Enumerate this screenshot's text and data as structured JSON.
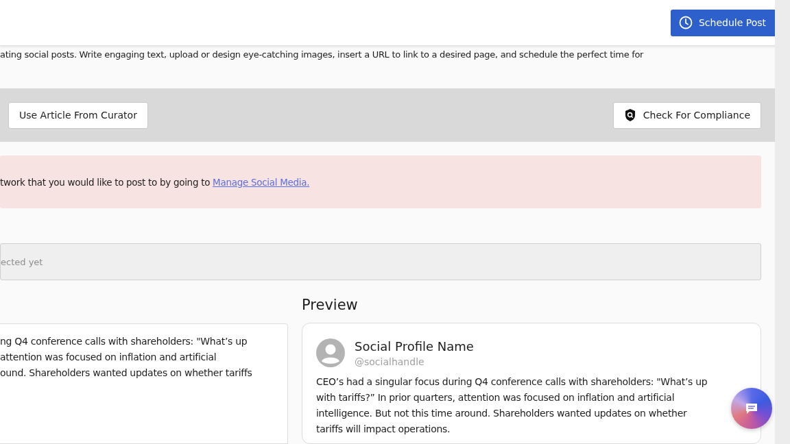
{
  "header": {
    "schedule_button": "Schedule Post"
  },
  "description": "ating social posts. Write engaging text, upload or design eye-catching images, insert a URL to link to a desired page, and schedule the perfect time for",
  "toolbar": {
    "left_button": "Use Article From Curator",
    "right_button": "Check For Compliance"
  },
  "alert": {
    "text": "twork that you would like to post to by going to ",
    "link": "Manage Social Media."
  },
  "selection_field": {
    "placeholder": "ected yet"
  },
  "editor": {
    "lines": [
      "ng Q4 conference calls with shareholders: \"What’s up",
      "attention was focused on inflation and artificial",
      "ound. Shareholders wanted updates on whether tariffs"
    ]
  },
  "preview": {
    "title": "Preview",
    "profile_name": "Social Profile Name",
    "handle": "@socialhandle",
    "body": "CEO’s had a singular focus during Q4 conference calls with shareholders: \"What’s up with tariffs?” In prior quarters, attention was focused on inflation and artificial intelligence. But not this time around. Shareholders wanted updates on whether tariffs will impact operations."
  }
}
